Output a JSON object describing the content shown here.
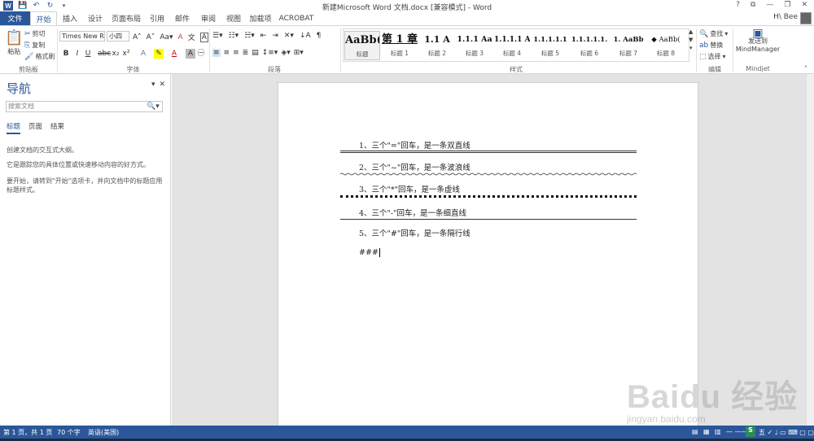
{
  "window": {
    "title": "新建Microsoft Word 文档.docx [兼容模式] - Word",
    "controls": [
      "?",
      "⧉",
      "—",
      "❐",
      "✕"
    ],
    "user": "H\\ Bee"
  },
  "quick_access": [
    "save-icon",
    "undo-icon",
    "redo-icon"
  ],
  "tabs": {
    "file": "文件",
    "items": [
      "开始",
      "插入",
      "设计",
      "页面布局",
      "引用",
      "邮件",
      "审阅",
      "视图",
      "加载项",
      "ACROBAT"
    ],
    "active": "开始"
  },
  "ribbon": {
    "clipboard": {
      "paste": "粘贴",
      "cut": "剪切",
      "copy": "复制",
      "format_painter": "格式刷",
      "label": "剪贴板"
    },
    "font": {
      "font_name": "Times New R",
      "font_size": "小四",
      "label": "字体"
    },
    "paragraph": {
      "label": "段落"
    },
    "styles": {
      "label": "样式",
      "items": [
        {
          "sample": "AaBb(",
          "name": "标题"
        },
        {
          "sample": "第 1 章",
          "name": "标题 1"
        },
        {
          "sample": "1.1  A",
          "name": "标题 2"
        },
        {
          "sample": "1.1.1  Aa",
          "name": "标题 3"
        },
        {
          "sample": "1.1.1.1  A",
          "name": "标题 4"
        },
        {
          "sample": "1.1.1.1.1",
          "name": "标题 5"
        },
        {
          "sample": "1.1.1.1.1.",
          "name": "标题 6"
        },
        {
          "sample": "1.  AaBb",
          "name": "标题 7"
        },
        {
          "sample": "◆  AaBb(",
          "name": "标题 8"
        }
      ]
    },
    "editing": {
      "find": "查找",
      "replace": "替换",
      "select": "选择",
      "label": "编辑"
    },
    "mindjet": {
      "send_line1": "发送到",
      "send_line2": "MindManager",
      "label": "Mindjet"
    }
  },
  "nav": {
    "title": "导航",
    "search_placeholder": "搜索文档",
    "tabs": [
      "标题",
      "页面",
      "结果"
    ],
    "hint1": "创建文档的交互式大纲。",
    "hint2": "它是跟踪您的具体位置或快速移动内容的好方式。",
    "hint3": "要开始，请转到\"开始\"选项卡，并向文档中的标题应用标题样式。"
  },
  "document": {
    "lines": [
      "1、三个\"=\"回车，是一条双直线",
      "2、三个\"~\"回车，是一条波浪线",
      "3、三个\"*\"回车，是一条虚线",
      "4、三个\"-\"回车，是一条细直线",
      "5、三个\"#\"回车，是一条隔行线"
    ],
    "typing": "###"
  },
  "status": {
    "page": "第 1 页，共 1 页",
    "words": "70 个字",
    "language": "英语(美国)"
  },
  "watermark": {
    "logo": "Baidu 经验",
    "url": "jingyan.baidu.com"
  },
  "colors": {
    "accent": "#2b579a"
  }
}
